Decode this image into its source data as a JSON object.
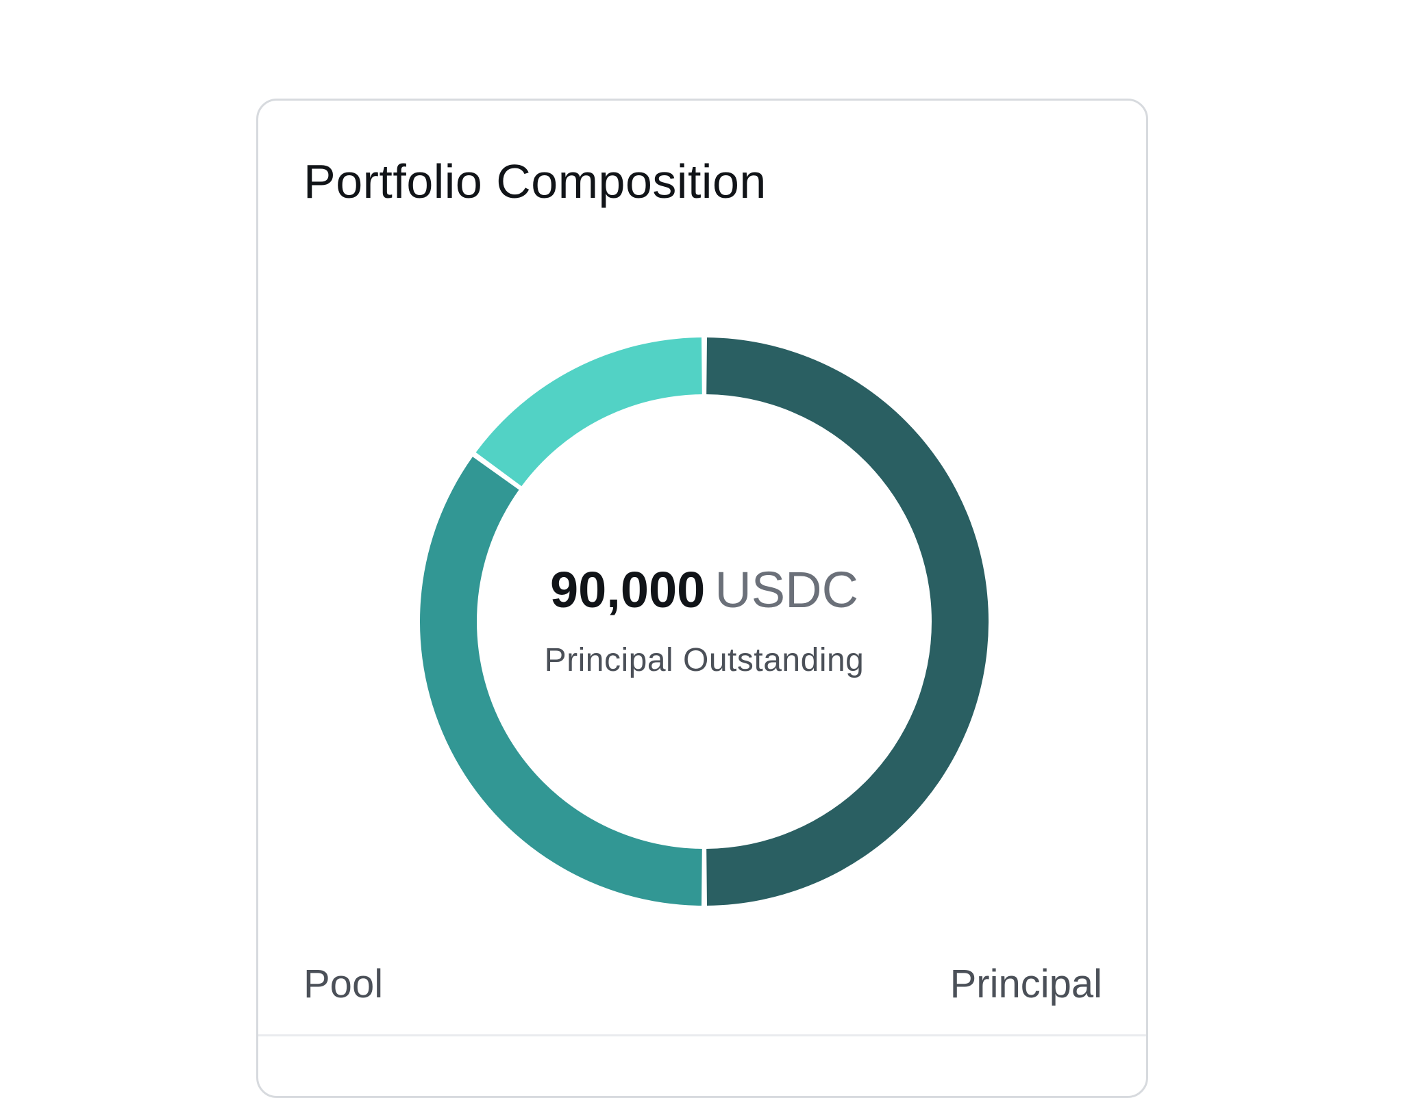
{
  "card": {
    "title": "Portfolio Composition"
  },
  "center": {
    "amount": "90,000",
    "unit": "USDC",
    "caption": "Principal Outstanding"
  },
  "labels": {
    "left": "Pool",
    "right": "Principal"
  },
  "colors": {
    "dark_teal": "#2a5f62",
    "mid_teal": "#329794",
    "light_teal": "#52d2c5"
  },
  "chart_data": {
    "type": "pie",
    "variant": "donut",
    "segments": [
      {
        "value": 50,
        "color": "#2a5f62"
      },
      {
        "value": 35,
        "color": "#329794"
      },
      {
        "value": 15,
        "color": "#52d2c5"
      }
    ]
  }
}
